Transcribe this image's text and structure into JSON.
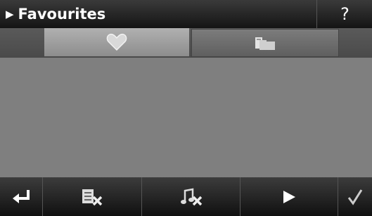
{
  "header": {
    "title": "Favourites",
    "help_label": "?"
  },
  "tabs": [
    {
      "icon": "heart-icon",
      "active": true
    },
    {
      "icon": "folder-icon",
      "active": false
    }
  ],
  "toolbar": {
    "buttons": [
      {
        "icon": "back-arrow-icon"
      },
      {
        "icon": "delete-list-icon"
      },
      {
        "icon": "delete-music-icon"
      },
      {
        "icon": "play-icon"
      },
      {
        "icon": "checkmark-icon"
      }
    ]
  },
  "colors": {
    "titlebar": "#1c1c1c",
    "content": "#7f7f7f",
    "active_tab": "#a3a3a3"
  }
}
